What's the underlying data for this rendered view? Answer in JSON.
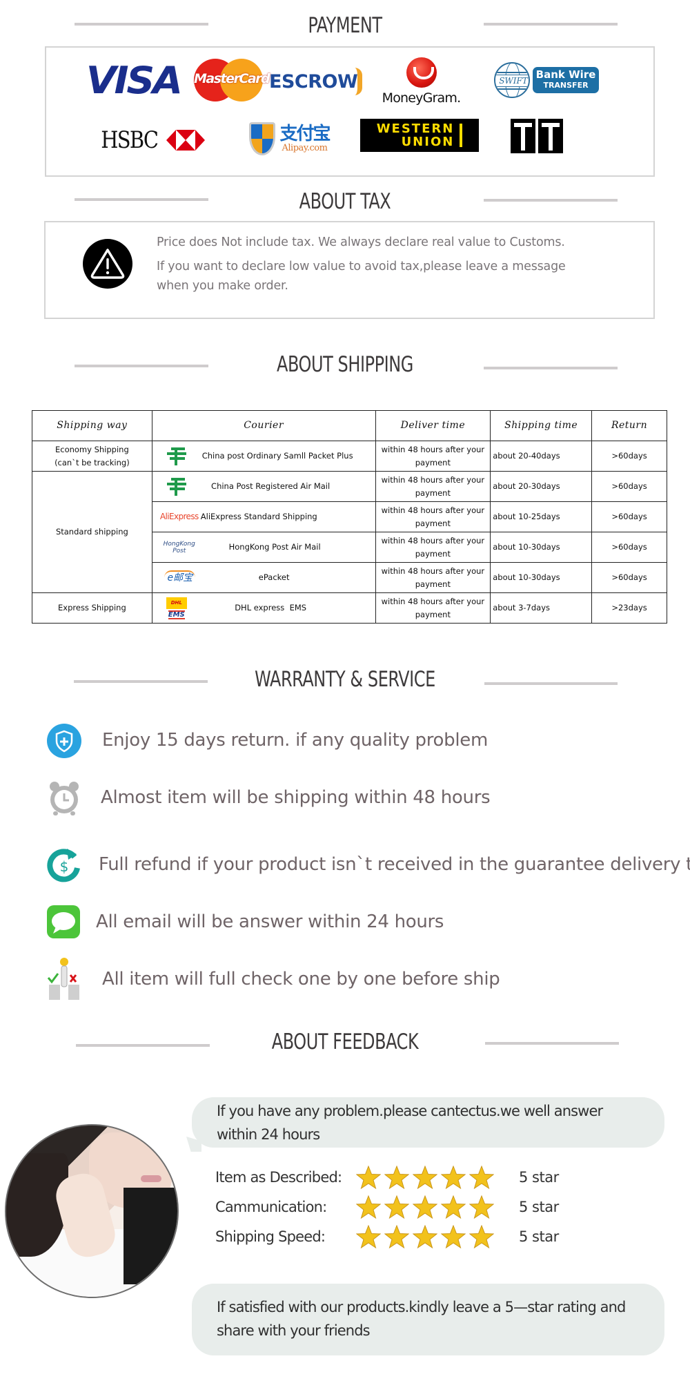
{
  "sections": {
    "payment": "PAYMENT",
    "tax": "ABOUT TAX",
    "shipping": "ABOUT SHIPPING",
    "warranty": "WARRANTY & SERVICE",
    "feedback": "ABOUT FEEDBACK"
  },
  "payment": {
    "logos": {
      "visa": "VISA",
      "mastercard": "MasterCard",
      "escrow": "ESCROW",
      "moneygram": "MoneyGram.",
      "swift": "SWIFT",
      "bankwire_line1": "Bank Wire",
      "bankwire_line2": "TRANSFER",
      "hsbc": "HSBC",
      "alipay_cn": "支付宝",
      "alipay": "Alipay.com",
      "western_union_line1": "WESTERN",
      "western_union_line2": "UNION",
      "tt": "TT"
    },
    "colors": {
      "visa": "#1a2e8c",
      "mastercard_red": "#e5231b",
      "mastercard_yellow": "#f7a21b",
      "western_union_yellow": "#ffdd00",
      "bankwire": "#1d6fa5",
      "hsbc_red": "#db0011"
    }
  },
  "tax": {
    "line1": "Price does Not include tax. We always declare real value to Customs.",
    "line2": "If you want to declare low value to avoid tax,please leave a message",
    "line3": "when you make order."
  },
  "shipping_table": {
    "headers": [
      "Shipping way",
      "Courier",
      "Deliver time",
      "Shipping time",
      "Return"
    ],
    "groups": [
      {
        "way": "Economy Shipping (can`t be tracking)",
        "way_line1": "Economy Shipping",
        "way_line2": "(can`t be tracking)"
      },
      {
        "way": "Standard shipping"
      },
      {
        "way": "Express Shipping"
      }
    ],
    "rows": [
      {
        "courier_logo": "China Post",
        "courier": "China post Ordinary Samll Packet Plus",
        "deliver": "within 48 hours after your payment",
        "shipping": "about 20-40days",
        "return": ">60days"
      },
      {
        "courier_logo": "China Post",
        "courier": "China Post Registered Air Mail",
        "deliver": "within 48 hours after your payment",
        "shipping": "about 20-30days",
        "return": ">60days"
      },
      {
        "courier_logo": "AliExpress",
        "courier": "AliExpress Standard Shipping",
        "deliver": "within 48 hours after your payment",
        "shipping": "about 10-25days",
        "return": ">60days"
      },
      {
        "courier_logo": "HongKong Post",
        "courier": "HongKong Post Air Mail",
        "deliver": "within 48 hours after your payment",
        "shipping": "about 10-30days",
        "return": ">60days"
      },
      {
        "courier_logo": "e邮宝",
        "courier": "ePacket",
        "deliver": "within 48 hours after your payment",
        "shipping": "about 10-30days",
        "return": ">60days"
      },
      {
        "courier_logo_1": "DHL",
        "courier_logo_2": "EMS",
        "courier": "DHL express  EMS",
        "deliver": "within 48 hours after your payment",
        "shipping": "about 3-7days",
        "return": ">23days"
      }
    ]
  },
  "warranty": {
    "items": [
      {
        "icon": "shield-icon",
        "text": "Enjoy 15 days return. if any quality problem"
      },
      {
        "icon": "alarm-clock-icon",
        "text": "Almost item will be shipping within 48 hours"
      },
      {
        "icon": "refund-icon",
        "text": "Full refund if your product isn`t received in the guarantee delivery time"
      },
      {
        "icon": "message-icon",
        "text": "All email will be answer within 24 hours"
      },
      {
        "icon": "quality-check-icon",
        "text": "All item will full check one by one before ship"
      }
    ],
    "colors": {
      "shield": "#2aa3e0",
      "refund": "#17a39a",
      "message": "#4cc53a",
      "text": "#6f6467"
    }
  },
  "feedback": {
    "bubble_top": "If you have any problem.please cantectus.we well answer within 24 hours",
    "bubble_top_line1": "If you have any problem.please cantectus.we well answer",
    "bubble_top_line2": "within 24 hours",
    "ratings": [
      {
        "label": "Item as Described:",
        "stars": 5,
        "max": 5,
        "value_text": "5 star"
      },
      {
        "label": "Cammunication:",
        "stars": 5,
        "max": 5,
        "value_text": "5 star"
      },
      {
        "label": "Shipping Speed:",
        "stars": 5,
        "max": 5,
        "value_text": "5 star"
      }
    ],
    "bubble_bottom_line1": "If satisfied with our products.kindly leave a 5—star rating and",
    "bubble_bottom_line2": "share with your friends",
    "star_color": "#f2c21c"
  }
}
